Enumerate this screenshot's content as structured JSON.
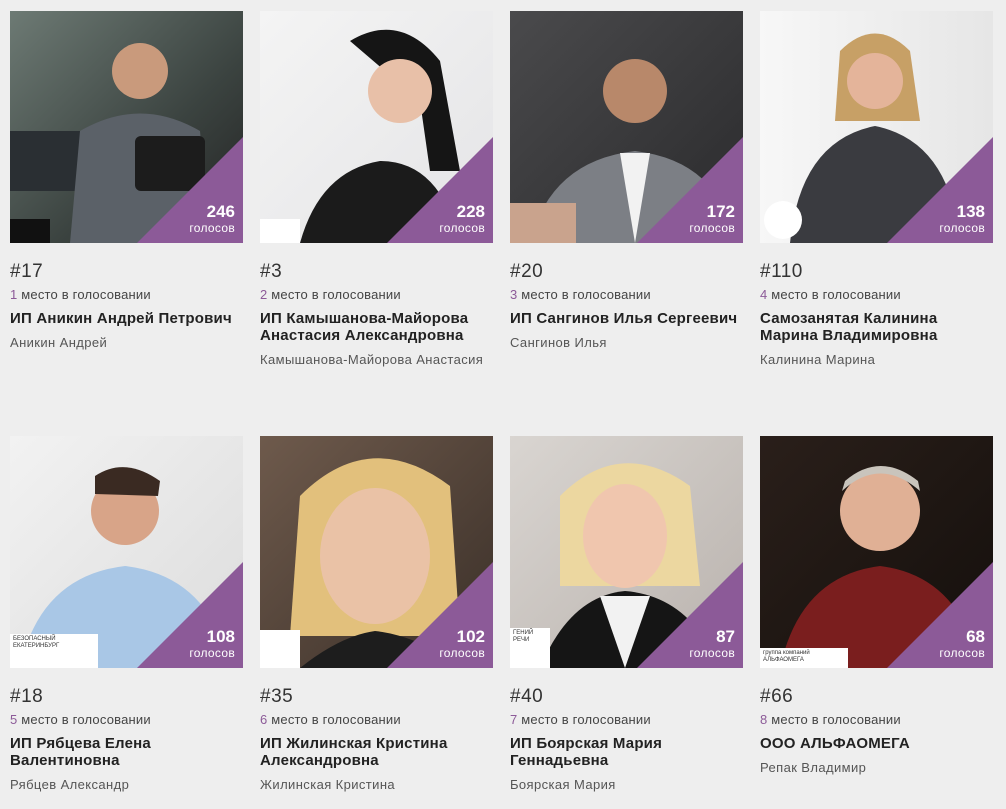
{
  "votes_label": "голосов",
  "place_label": "место в голосовании",
  "accent_color": "#8c5a98",
  "cards": [
    {
      "num": "#17",
      "place": "1",
      "votes": "246",
      "org": "ИП Аникин Андрей Петрович",
      "owner": "Аникин Андрей"
    },
    {
      "num": "#3",
      "place": "2",
      "votes": "228",
      "org": "ИП Камышанова-Майорова Анастасия Александровна",
      "owner": "Камышанова-Майорова Анастасия"
    },
    {
      "num": "#20",
      "place": "3",
      "votes": "172",
      "org": "ИП Сангинов Илья Сергеевич",
      "owner": "Сангинов Илья"
    },
    {
      "num": "#110",
      "place": "4",
      "votes": "138",
      "org": "Самозанятая Калинина Марина Владимировна",
      "owner": "Калинина Марина"
    },
    {
      "num": "#18",
      "place": "5",
      "votes": "108",
      "org": "ИП Рябцева Елена Валентиновна",
      "owner": "Рябцев Александр",
      "logo": "БЕЗОПАСНЫЙ ЕКАТЕРИНБУРГ"
    },
    {
      "num": "#35",
      "place": "6",
      "votes": "102",
      "org": "ИП Жилинская Кристина Александровна",
      "owner": "Жилинская Кристина"
    },
    {
      "num": "#40",
      "place": "7",
      "votes": "87",
      "org": "ИП Боярская Мария Геннадьевна",
      "owner": "Боярская Мария",
      "logo": "ГЕНИЙ РЕЧИ"
    },
    {
      "num": "#66",
      "place": "8",
      "votes": "68",
      "org": "ООО АЛЬФАОМЕГА",
      "owner": "Репак Владимир",
      "logo": "группа компаний АЛЬФАОМЕГА"
    }
  ]
}
